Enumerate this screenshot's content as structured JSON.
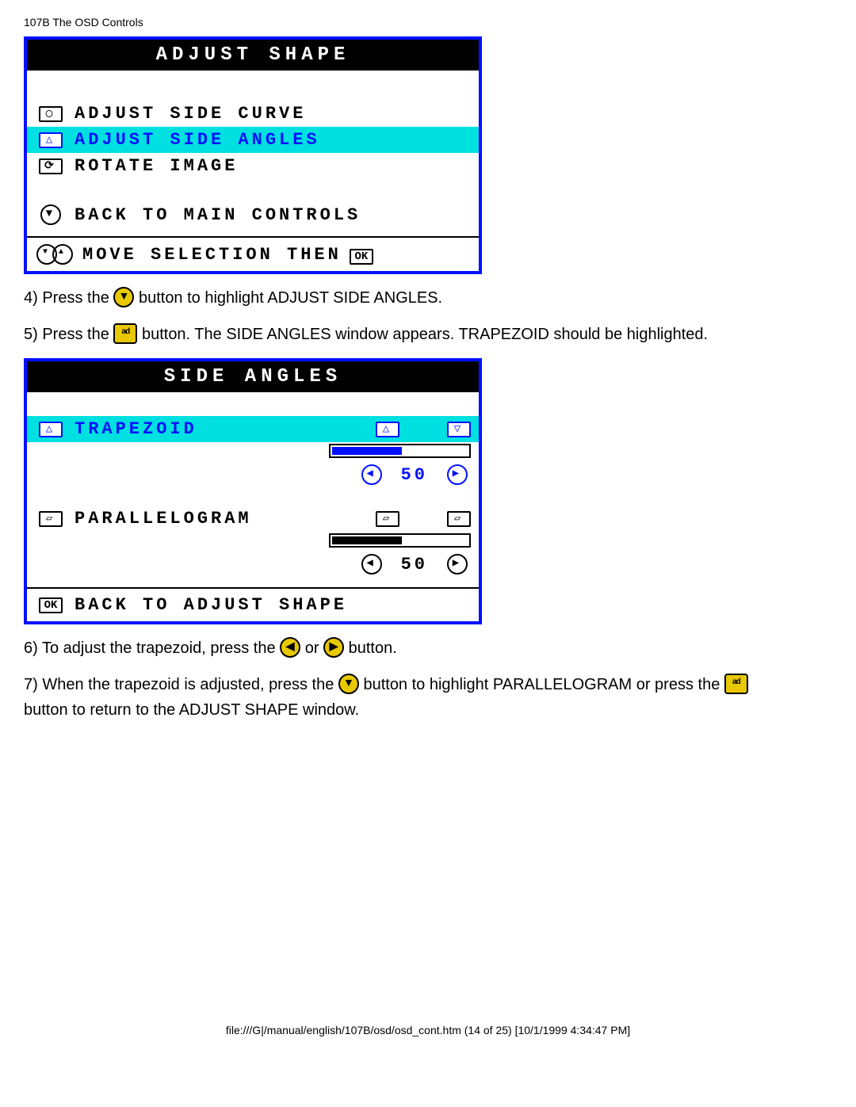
{
  "header": "107B The OSD Controls",
  "osd1": {
    "title": "ADJUST SHAPE",
    "items": [
      {
        "label": "ADJUST SIDE CURVE"
      },
      {
        "label": "ADJUST SIDE ANGLES"
      },
      {
        "label": "ROTATE IMAGE"
      }
    ],
    "back": "BACK TO MAIN CONTROLS",
    "footer": "MOVE SELECTION THEN"
  },
  "step4": {
    "a": "4) Press the ",
    "b": " button to highlight ADJUST SIDE ANGLES."
  },
  "step5": {
    "a": "5) Press the ",
    "b": " button. The SIDE ANGLES window appears. TRAPEZOID should be highlighted."
  },
  "osd2": {
    "title": "SIDE ANGLES",
    "trapezoid": {
      "label": "TRAPEZOID",
      "value": "50"
    },
    "parallelogram": {
      "label": "PARALLELOGRAM",
      "value": "50"
    },
    "back": "BACK TO ADJUST SHAPE"
  },
  "step6": {
    "a": "6) To adjust the trapezoid, press the ",
    "b": " or ",
    "c": " button."
  },
  "step7": {
    "a": "7) When the trapezoid is adjusted, press the ",
    "b": " button to highlight PARALLELOGRAM or press the ",
    "c": "button to return to the ADJUST SHAPE window."
  },
  "footer": "file:///G|/manual/english/107B/osd/osd_cont.htm (14 of 25) [10/1/1999 4:34:47 PM]"
}
